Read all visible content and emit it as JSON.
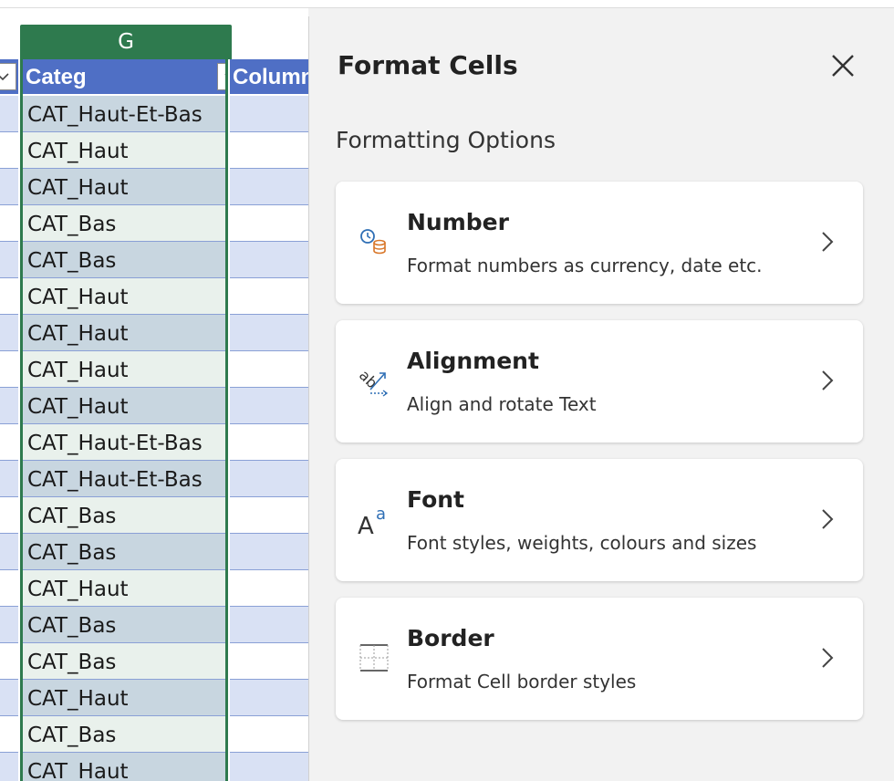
{
  "sheet": {
    "column_letter": "G",
    "header_categ": "Categ",
    "header_column": "Column",
    "cells": [
      "CAT_Haut-Et-Bas",
      "CAT_Haut",
      "CAT_Haut",
      "CAT_Bas",
      "CAT_Bas",
      "CAT_Haut",
      "CAT_Haut",
      "CAT_Haut",
      "CAT_Haut",
      "CAT_Haut-Et-Bas",
      "CAT_Haut-Et-Bas",
      "CAT_Bas",
      "CAT_Bas",
      "CAT_Haut",
      "CAT_Bas",
      "CAT_Bas",
      "CAT_Haut",
      "CAT_Bas",
      "CAT_Haut"
    ]
  },
  "pane": {
    "title": "Format Cells",
    "section_label": "Formatting Options",
    "options": [
      {
        "title": "Number",
        "description": "Format numbers as currency, date etc.",
        "icon": "number-format-icon"
      },
      {
        "title": "Alignment",
        "description": "Align and rotate Text",
        "icon": "alignment-icon"
      },
      {
        "title": "Font",
        "description": "Font styles, weights, colours and sizes",
        "icon": "font-icon"
      },
      {
        "title": "Border",
        "description": "Format Cell border styles",
        "icon": "border-icon"
      }
    ]
  },
  "colors": {
    "header_blue": "#4f6fc5",
    "column_green": "#2e7a4e",
    "band_blue": "#d9e1f4",
    "accent_icon_blue": "#2f6fb5",
    "accent_icon_orange": "#d9772a"
  }
}
